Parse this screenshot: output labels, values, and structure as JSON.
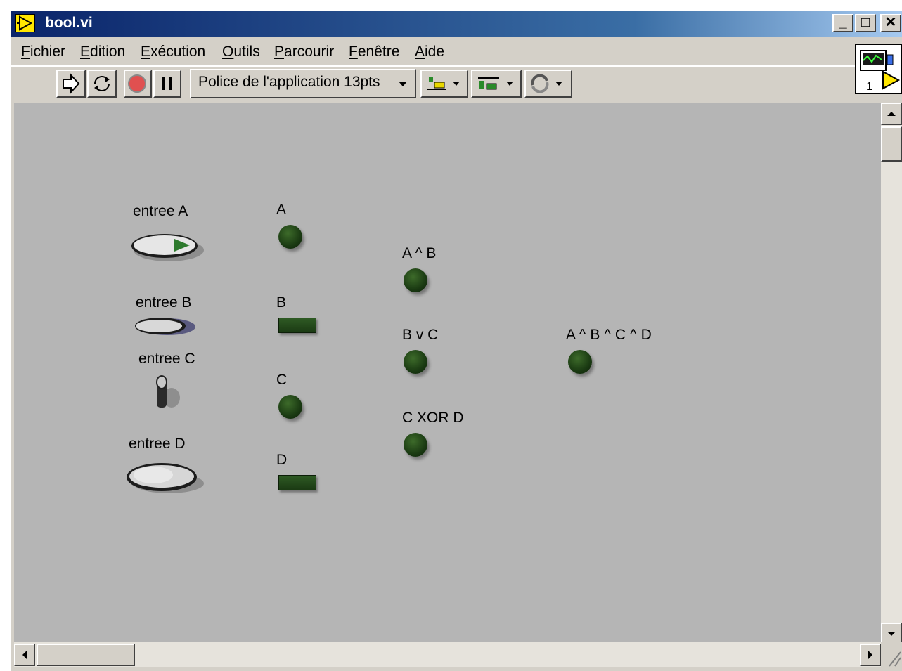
{
  "window": {
    "title": "bool.vi",
    "minimize": "_",
    "maximize": "□",
    "close": "✕"
  },
  "menu": [
    {
      "label": "Fichier",
      "u": "F",
      "rest": "ichier"
    },
    {
      "label": "Edition",
      "u": "E",
      "rest": "dition"
    },
    {
      "label": "Exécution",
      "u": "E",
      "rest": "xécution"
    },
    {
      "label": "Outils",
      "u": "O",
      "rest": "utils"
    },
    {
      "label": "Parcourir",
      "u": "P",
      "rest": "arcourir"
    },
    {
      "label": "Fenêtre",
      "u": "F",
      "rest": "enêtre"
    },
    {
      "label": "Aide",
      "u": "A",
      "rest": "ide"
    }
  ],
  "toolbar": {
    "font": "Police de l'application 13pts"
  },
  "vi_icon": {
    "connector_number": "1"
  },
  "controls": {
    "a": {
      "label": "entree A"
    },
    "b": {
      "label": "entree B"
    },
    "c": {
      "label": "entree C"
    },
    "d": {
      "label": "entree D"
    }
  },
  "indicators": {
    "a": "A",
    "b": "B",
    "c": "C",
    "d": "D",
    "a_and_b": "A ^ B",
    "b_or_c": "B v C",
    "c_xor_d": "C XOR D",
    "a_and_b_and_c_and_d": "A ^ B ^ C ^ D"
  }
}
